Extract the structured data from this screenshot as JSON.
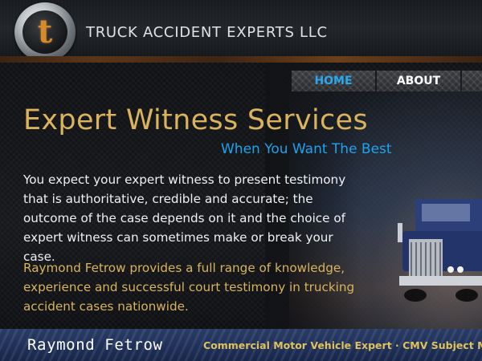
{
  "header": {
    "logo_letter": "t",
    "site_title": "TRUCK ACCIDENT EXPERTS LLC"
  },
  "nav": {
    "items": [
      {
        "label": "HOME",
        "active": true
      },
      {
        "label": "ABOUT",
        "active": false
      },
      {
        "label": "",
        "active": false
      }
    ]
  },
  "main": {
    "title": "Expert Witness Services",
    "subtitle": "When You Want The Best",
    "paragraph1": "You expect your expert witness to present testimony that is authoritative, credible and accurate; the outcome of the case depends on it and the choice of expert witness can sometimes make or break your case.",
    "paragraph2": "Raymond Fetrow provides a full range of knowledge, experience and successful court testimony in trucking accident cases nationwide."
  },
  "footer": {
    "name": "Raymond Fetrow",
    "tagline": "Commercial Motor Vehicle Expert  ·  CMV Subject Mat"
  },
  "colors": {
    "gold": "#d9b35d",
    "accent_blue": "#1da3ee",
    "footer_blue": "#1f3059",
    "logo_orange": "#d68a2a"
  },
  "icons": {
    "logo": "truck-accident-logo-icon",
    "truck": "semi-truck-illustration"
  }
}
